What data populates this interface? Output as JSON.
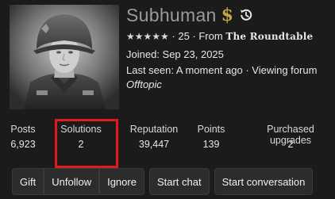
{
  "profile": {
    "username": "Subhuman",
    "badge_symbol": "$",
    "icons": {
      "badge": "dollar-badge-icon",
      "history": "history-icon"
    },
    "stars": "★★★★★",
    "rating_text": " · 25 · From ",
    "forum_name": "The Roundtable",
    "joined": "Joined: Sep 23, 2025",
    "last_seen_prefix": "Last seen: A moment ago · ",
    "last_seen_activity": "Viewing forum",
    "forum_section": "Offtopic"
  },
  "stats": [
    {
      "label": "Posts",
      "value": "6,923"
    },
    {
      "label": "Solutions",
      "value": "2"
    },
    {
      "label": "Reputation",
      "value": "39,447"
    },
    {
      "label": "Points",
      "value": "139"
    },
    {
      "label": "Purchased upgrades",
      "value": "2"
    }
  ],
  "actions": {
    "gift": "Gift",
    "unfollow": "Unfollow",
    "ignore": "Ignore",
    "start_chat": "Start chat",
    "start_conversation": "Start conversation"
  },
  "colors": {
    "background": "#1b1b1b",
    "username": "#9a9a9a",
    "badge_gold": "#c8a442",
    "highlight_box": "#e01b1b"
  }
}
